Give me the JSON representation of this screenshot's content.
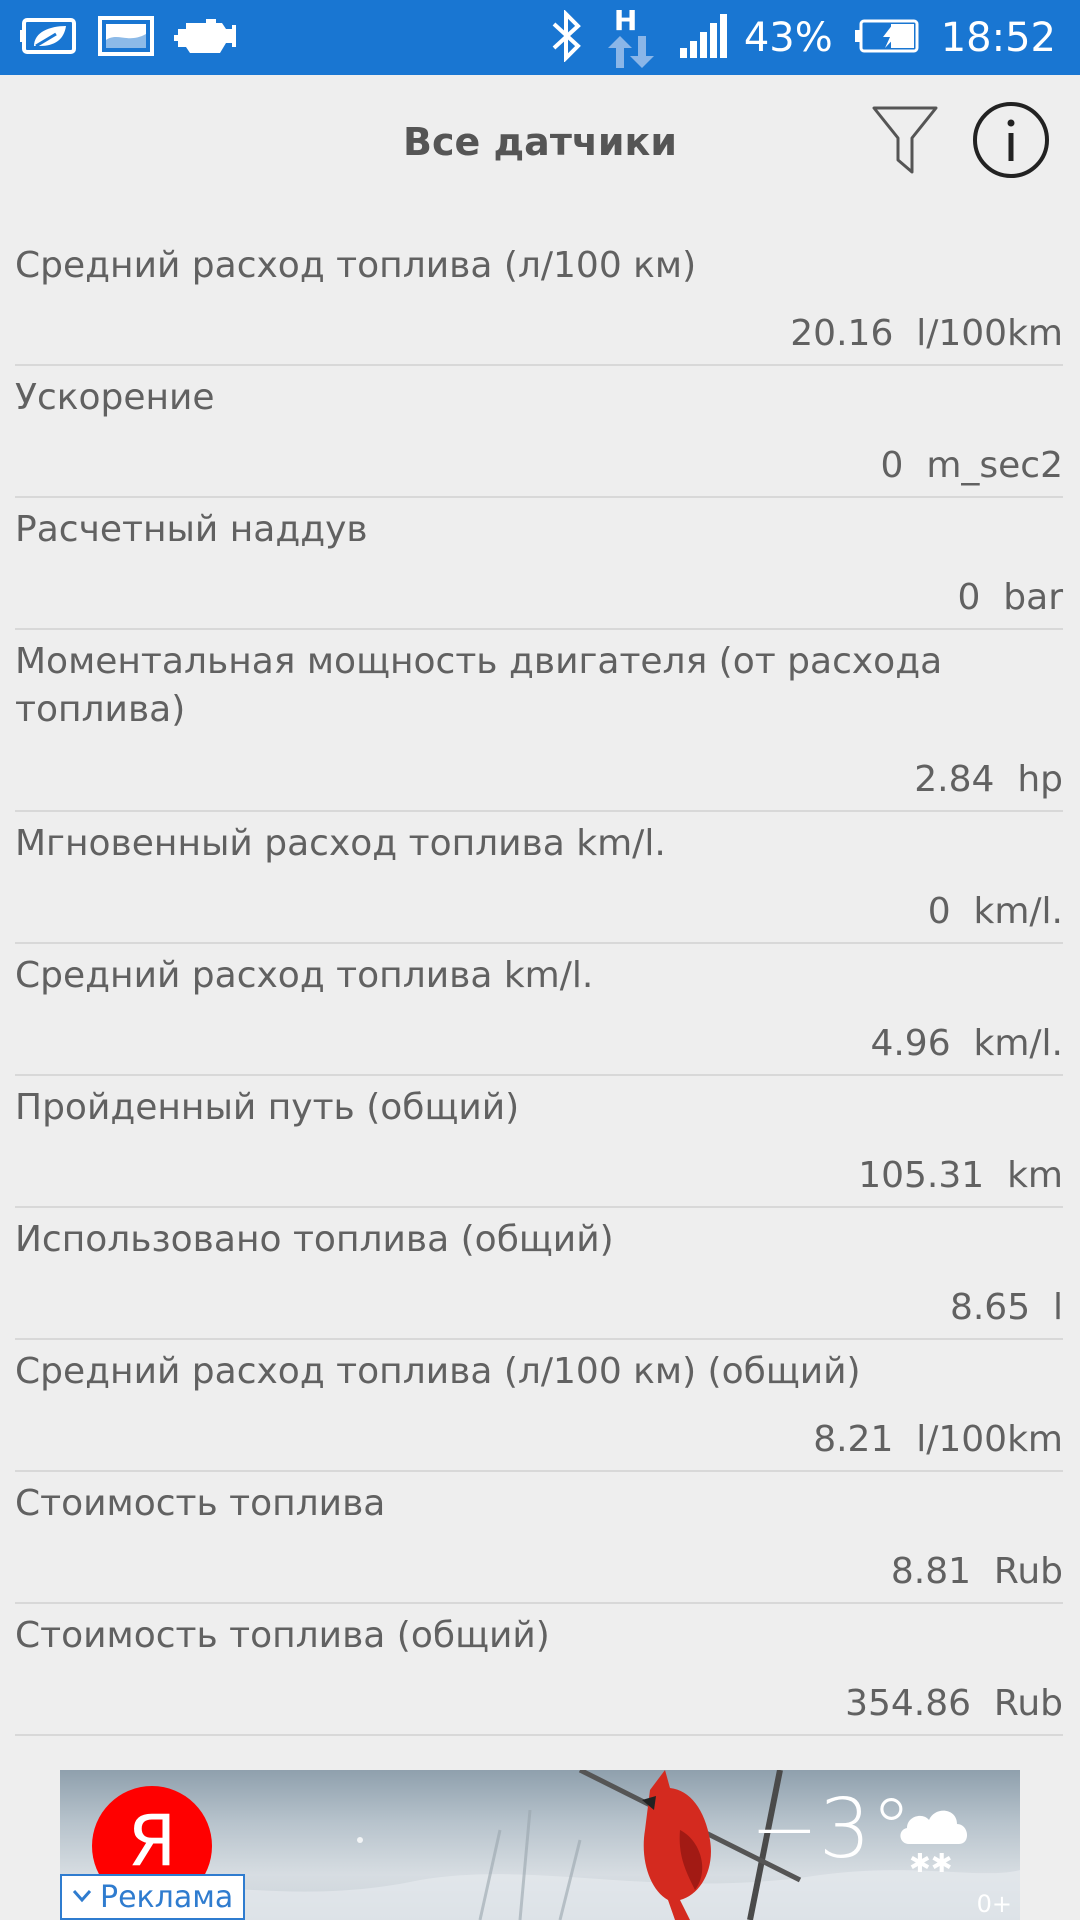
{
  "status_bar": {
    "battery_percent": "43%",
    "time": "18:52",
    "network_type": "H",
    "icons": [
      "leaf-battery-icon",
      "image-icon",
      "engine-icon",
      "bluetooth-icon",
      "data-transfer-icon",
      "signal-icon",
      "battery-charging-icon"
    ]
  },
  "header": {
    "title": "Все датчики",
    "filter_icon": "filter-icon",
    "info_icon": "info-icon"
  },
  "sensors": [
    {
      "name": "Средний расход топлива (л/100 км)",
      "value": "20.16  l/100km"
    },
    {
      "name": "Ускорение",
      "value": "0  m_sec2"
    },
    {
      "name": "Расчетный наддув",
      "value": "0  bar"
    },
    {
      "name": "Моментальная мощность двигателя (от расхода топлива)",
      "value": "2.84  hp"
    },
    {
      "name": "Мгновенный расход топлива km/l.",
      "value": "0  km/l."
    },
    {
      "name": "Средний расход топлива km/l.",
      "value": "4.96  km/l."
    },
    {
      "name": "Пройденный путь (общий)",
      "value": "105.31  km"
    },
    {
      "name": "Использовано топлива (общий)",
      "value": "8.65  l"
    },
    {
      "name": "Средний расход топлива (л/100 км) (общий)",
      "value": "8.21  l/100km"
    },
    {
      "name": "Стоимость топлива",
      "value": "8.81  Rub"
    },
    {
      "name": "Стоимость топлива (общий)",
      "value": "354.86  Rub"
    }
  ],
  "ad": {
    "logo_letter": "Я",
    "temperature": "−3°",
    "age_rating": "0+",
    "label": "Реклама"
  },
  "colors": {
    "status_bar": "#1976d2",
    "background": "#eeeeee",
    "text": "#616161",
    "divider": "#d8d8d8",
    "ad_accent": "#2f7ccf",
    "ad_logo": "#ff0000"
  }
}
